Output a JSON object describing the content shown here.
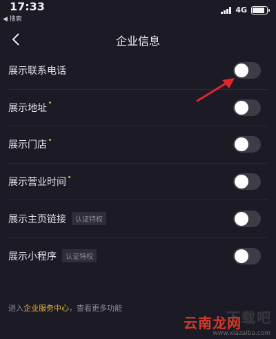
{
  "status_bar": {
    "time": "17:33",
    "back_app": "◀ 搜索",
    "network": "4G"
  },
  "nav": {
    "title": "企业信息"
  },
  "settings": {
    "items": [
      {
        "label": "展示联系电话",
        "required": false,
        "tag": "",
        "enabled": false
      },
      {
        "label": "展示地址",
        "required": true,
        "tag": "",
        "enabled": false
      },
      {
        "label": "展示门店",
        "required": true,
        "tag": "",
        "enabled": false
      },
      {
        "label": "展示营业时间",
        "required": true,
        "tag": "",
        "enabled": false
      },
      {
        "label": "展示主页链接",
        "required": false,
        "tag": "认证特权",
        "enabled": false
      },
      {
        "label": "展示小程序",
        "required": false,
        "tag": "认证特权",
        "enabled": false
      }
    ]
  },
  "footer": {
    "prefix": "进入",
    "link": "企业服务中心",
    "suffix": "，查看更多功能"
  },
  "watermark": {
    "main": "下载吧",
    "brand": "云南龙网",
    "url": "www.xiazaiba.com"
  },
  "colors": {
    "background": "#1c1b25",
    "accent": "#e3b13a",
    "annotation_arrow": "#e0262e"
  }
}
